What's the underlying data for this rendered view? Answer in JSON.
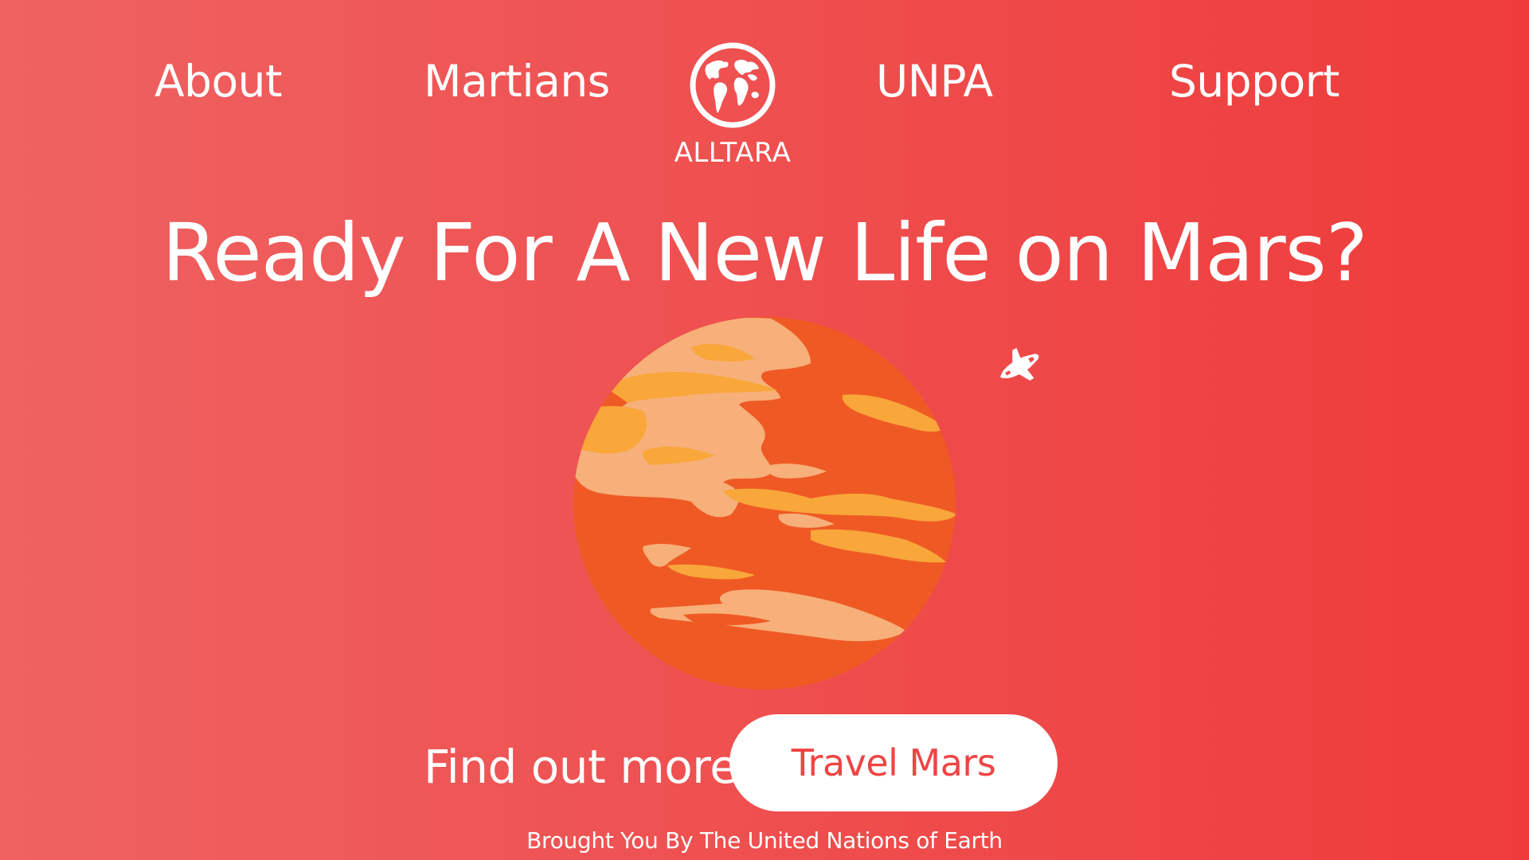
{
  "nav": {
    "about": "About",
    "martians": "Martians",
    "unpa": "UNPA",
    "support": "Support"
  },
  "logo": {
    "icon": "globe-icon",
    "text": "ALLTARA"
  },
  "hero": {
    "headline": "Ready For A New Life on Mars?",
    "illustration": "mars-planet",
    "decoration_icon": "space-shuttle-icon"
  },
  "actions": {
    "find_more": "Find out more",
    "travel_button": "Travel Mars"
  },
  "footer": {
    "credit": "Brought You By The United Nations of Earth"
  },
  "colors": {
    "background_start": "#ef6262",
    "background_end": "#ef3b3b",
    "text": "#ffffff",
    "button_bg": "#ffffff",
    "button_text": "#ef4444",
    "planet_base": "#ef5a24",
    "planet_light": "#f7b07a",
    "planet_mid": "#f9a63a"
  }
}
